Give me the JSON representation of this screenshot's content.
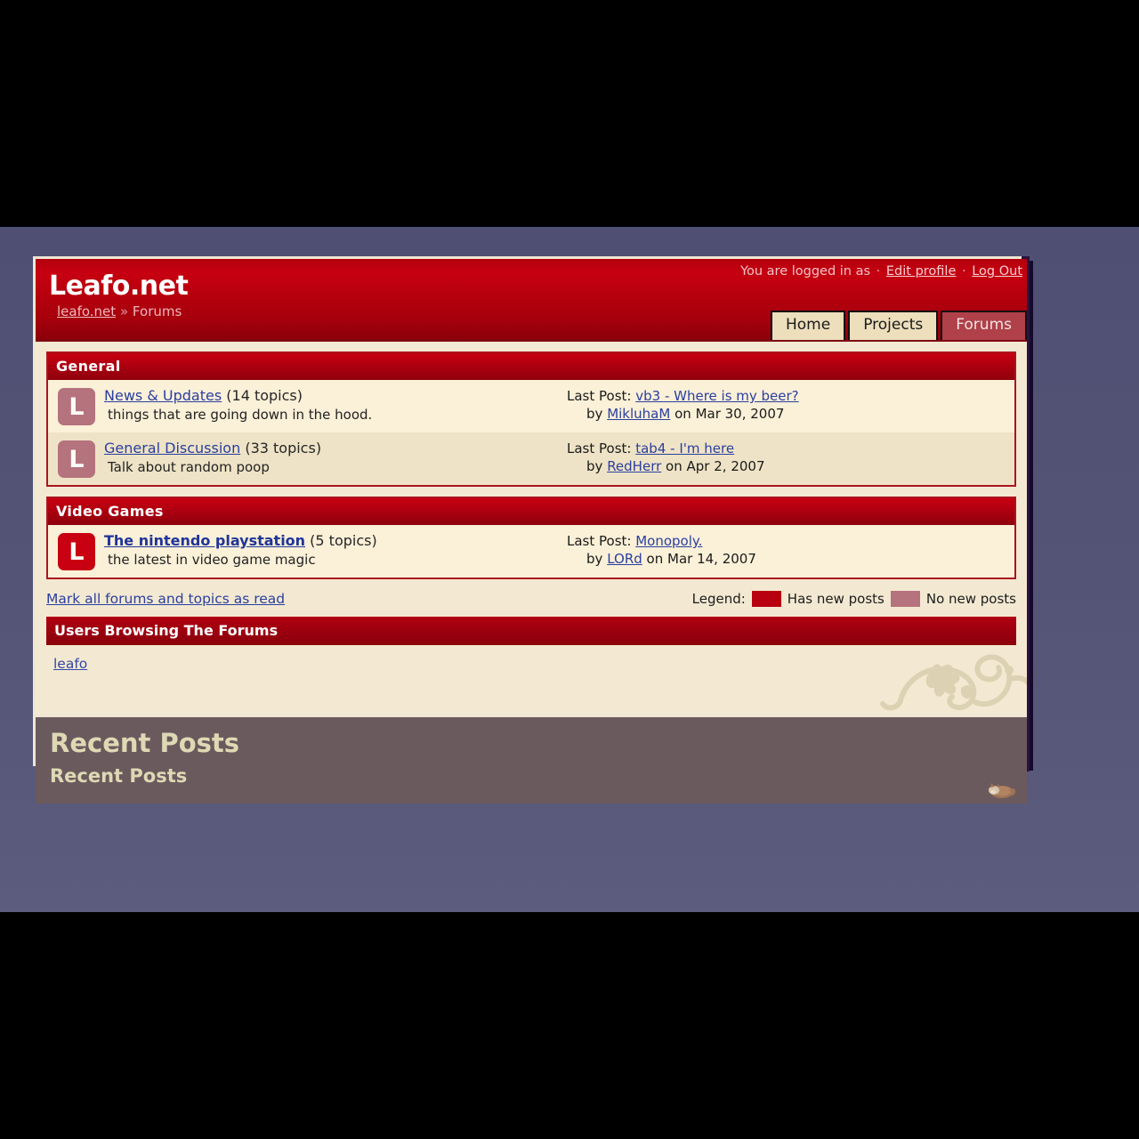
{
  "header": {
    "site_title": "Leafo.net",
    "breadcrumb_home": "leafo.net",
    "breadcrumb_sep": "»",
    "breadcrumb_current": "Forums",
    "login_text": "You are logged in as",
    "dot1": "·",
    "edit_profile": "Edit profile",
    "dot2": "·",
    "log_out": "Log Out",
    "tabs": [
      {
        "label": "Home",
        "active": false
      },
      {
        "label": "Projects",
        "active": false
      },
      {
        "label": "Forums",
        "active": true
      }
    ]
  },
  "sections": [
    {
      "title": "General",
      "forums": [
        {
          "icon_letter": "L",
          "icon_state": "old",
          "name": "News & Updates",
          "topics": "(14 topics)",
          "description": "things that are going down in the hood.",
          "last_post_label": "Last Post:",
          "last_post_title": "vb3 - Where is my beer?",
          "by_label": "by",
          "author": "MikluhaM",
          "on_label": "on",
          "date": "Mar 30, 2007",
          "bold_title": false
        },
        {
          "icon_letter": "L",
          "icon_state": "old",
          "name": "General Discussion",
          "topics": "(33 topics)",
          "description": "Talk about random poop",
          "last_post_label": "Last Post:",
          "last_post_title": "tab4 - I'm here",
          "by_label": "by",
          "author": "RedHerr",
          "on_label": "on",
          "date": "Apr 2, 2007",
          "bold_title": false
        }
      ]
    },
    {
      "title": "Video Games",
      "forums": [
        {
          "icon_letter": "L",
          "icon_state": "new",
          "name": "The nintendo playstation",
          "topics": "(5 topics)",
          "description": "the latest in video game magic",
          "last_post_label": "Last Post:",
          "last_post_title": "Monopoly.",
          "by_label": "by",
          "author": "LORd",
          "on_label": "on",
          "date": "Mar 14, 2007",
          "bold_title": true
        }
      ]
    }
  ],
  "mark_read_link": "Mark all forums and topics as read",
  "legend": {
    "label": "Legend:",
    "has_new": "Has new posts",
    "no_new": "No new posts",
    "color_new": "#b80010",
    "color_old": "#b5737e"
  },
  "users_browsing": {
    "title": "Users Browsing The Forums",
    "users": [
      "leafo"
    ]
  },
  "footer": {
    "title": "Recent Posts",
    "subtitle": "Recent Posts"
  }
}
